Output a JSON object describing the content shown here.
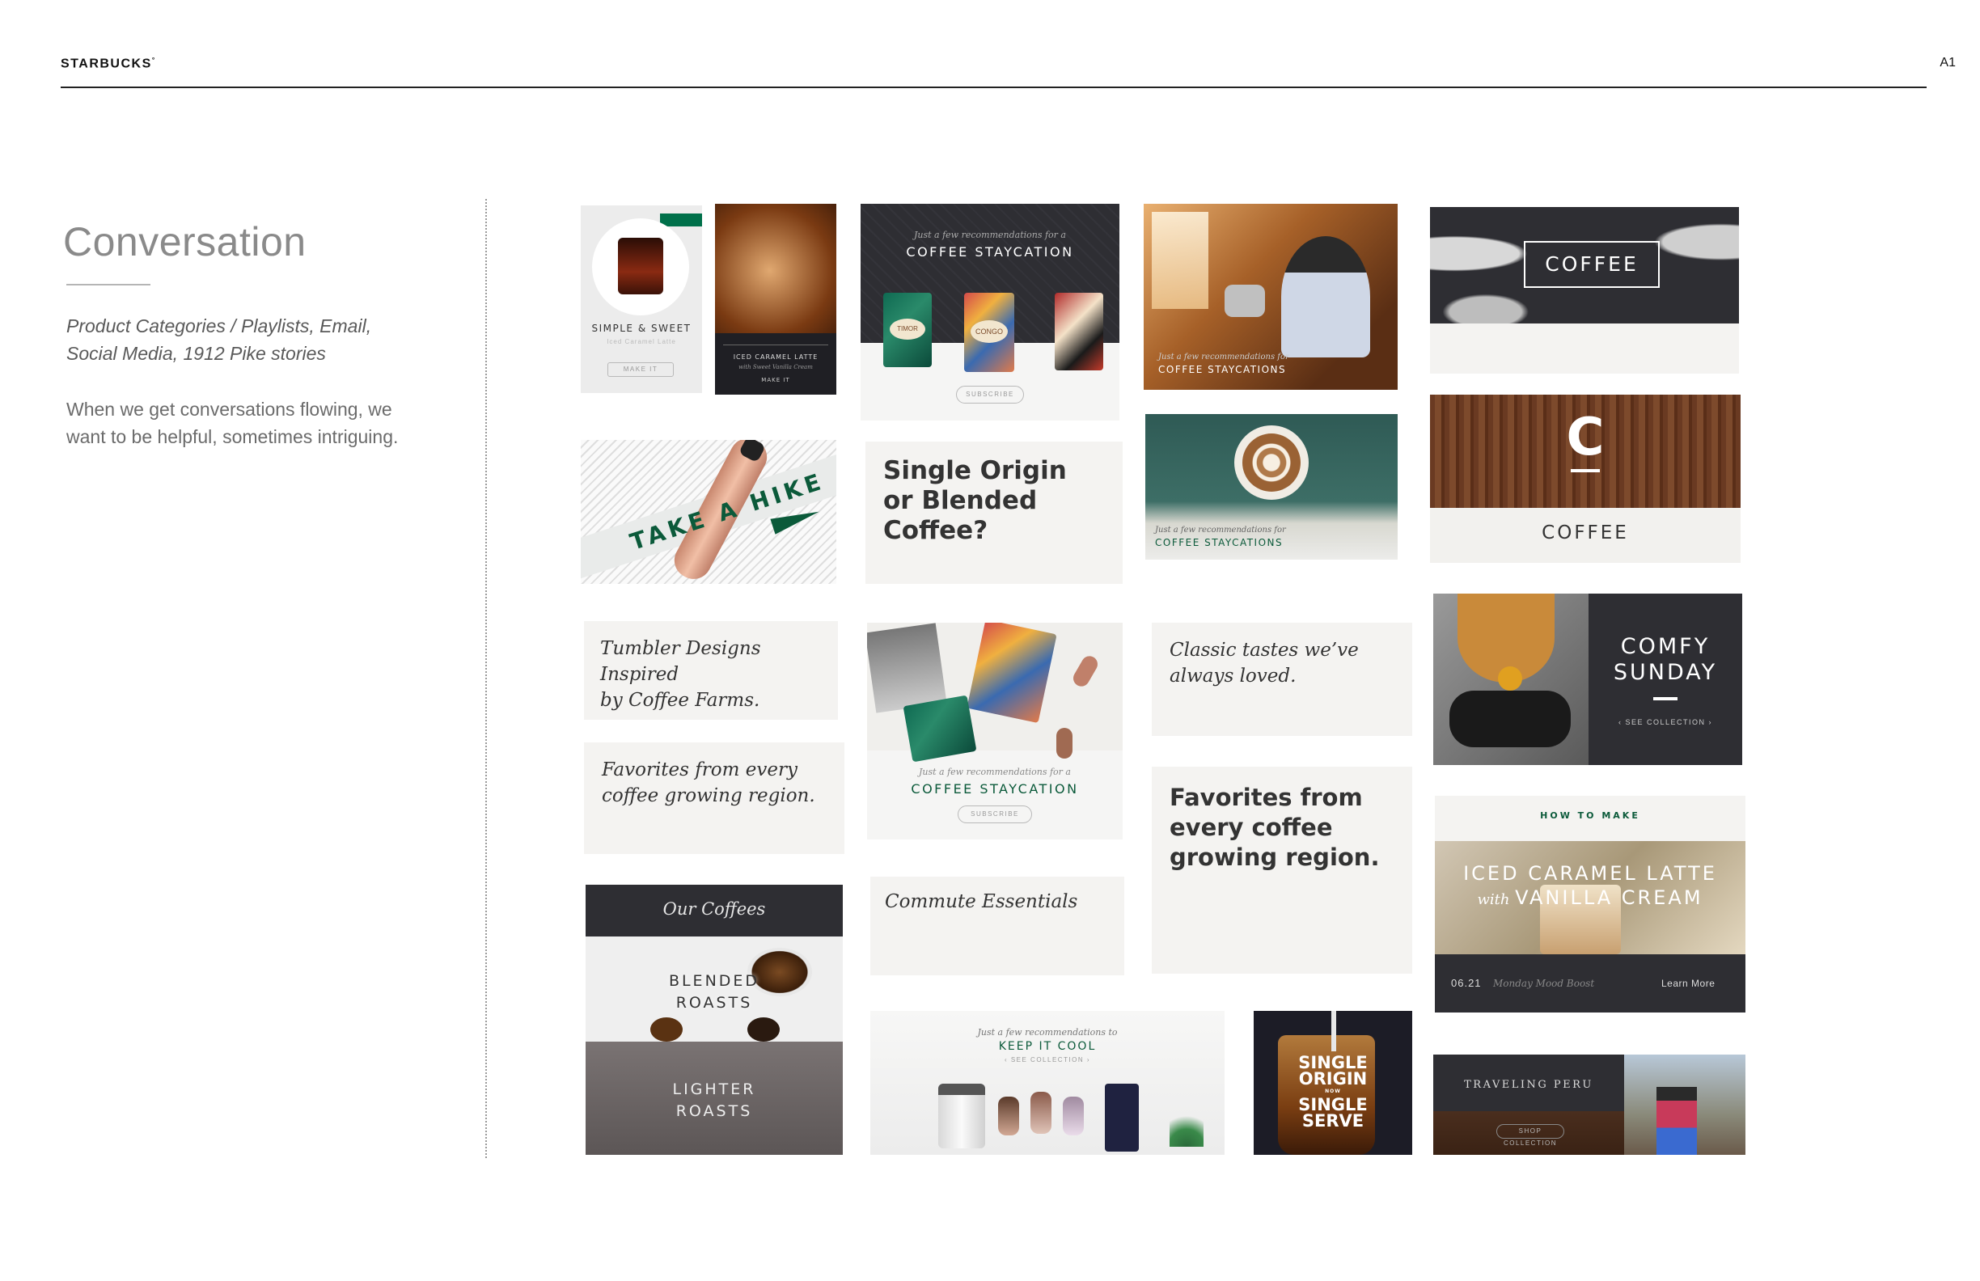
{
  "header": {
    "brand": "STARBUCKS",
    "brand_mark": "°",
    "page_number": "A1"
  },
  "section": {
    "title": "Conversation",
    "subtitle_line1": "Product Categories / Playlists, Email,",
    "subtitle_line2": "Social Media, 1912 Pike stories",
    "body_line1": "When we get conversations flowing, we",
    "body_line2": "want to be helpful, sometimes intriguing."
  },
  "tiles": {
    "simple_sweet": {
      "title": "SIMPLE & SWEET",
      "sub": "Iced Caramel Latte",
      "button": "MAKE IT"
    },
    "iced_caramel_small": {
      "title": "ICED CARAMEL LATTE",
      "sub": "with Sweet Vanilla Cream",
      "button": "MAKE IT"
    },
    "staycation_1": {
      "kicker": "Just a few recommendations for a",
      "title": "COFFEE STAYCATION",
      "button": "SUBSCRIBE",
      "bag1": "TIMOR",
      "bag2": "CONGO"
    },
    "barista": {
      "kicker": "Just a few recommendations for",
      "title": "COFFEE STAYCATIONS"
    },
    "coffee_leaves": {
      "label": "COFFEE"
    },
    "take_hike": {
      "label": "TAKE A HIKE"
    },
    "single_origin_q": {
      "line1": "Single Origin",
      "line2": "or Blended Coffee?"
    },
    "latte_art": {
      "kicker": "Just a few recommendations for",
      "title": "COFFEE STAYCATIONS"
    },
    "c_coffee": {
      "letter": "C",
      "label": "COFFEE"
    },
    "tumbler": {
      "line1": "Tumbler Designs Inspired",
      "line2": "by Coffee Farms."
    },
    "staycation_2": {
      "kicker": "Just a few recommendations for a",
      "title": "COFFEE STAYCATION",
      "button": "SUBSCRIBE"
    },
    "classic": {
      "line1": "Classic tastes we’ve",
      "line2": "always loved."
    },
    "comfy": {
      "line1": "COMFY",
      "line2": "SUNDAY",
      "link": "‹ SEE COLLECTION ›"
    },
    "favorites_serif": {
      "line1": "Favorites from every",
      "line2": "coffee growing region."
    },
    "favorites_bold": {
      "line1": "Favorites from",
      "line2": "every coffee",
      "line3": "growing region."
    },
    "how_to": {
      "kicker": "HOW TO MAKE",
      "line1": "ICED CARAMEL LATTE",
      "with": "with",
      "line2": "VANILLA CREAM",
      "date": "06.21",
      "tag": "Monday Mood Boost",
      "link": "Learn More"
    },
    "our_coffees": {
      "title": "Our Coffees",
      "blended1": "BLENDED",
      "blended2": "ROASTS",
      "lighter1": "LIGHTER",
      "lighter2": "ROASTS"
    },
    "commute": {
      "label": "Commute Essentials"
    },
    "keep_cool": {
      "kicker": "Just a few recommendations to",
      "title": "KEEP IT COOL",
      "link": "‹ SEE COLLECTION ›"
    },
    "single_serve": {
      "line1": "SINGLE",
      "line2": "ORIGIN",
      "now": "NOW",
      "line3": "SINGLE",
      "line4": "SERVE"
    },
    "peru": {
      "title": "TRAVELING PERU",
      "button": "SHOP COLLECTION"
    }
  },
  "colors": {
    "starbucks_green": "#00704a",
    "dark_slate": "#2e2e33",
    "tile_light": "#f4f3f1"
  }
}
